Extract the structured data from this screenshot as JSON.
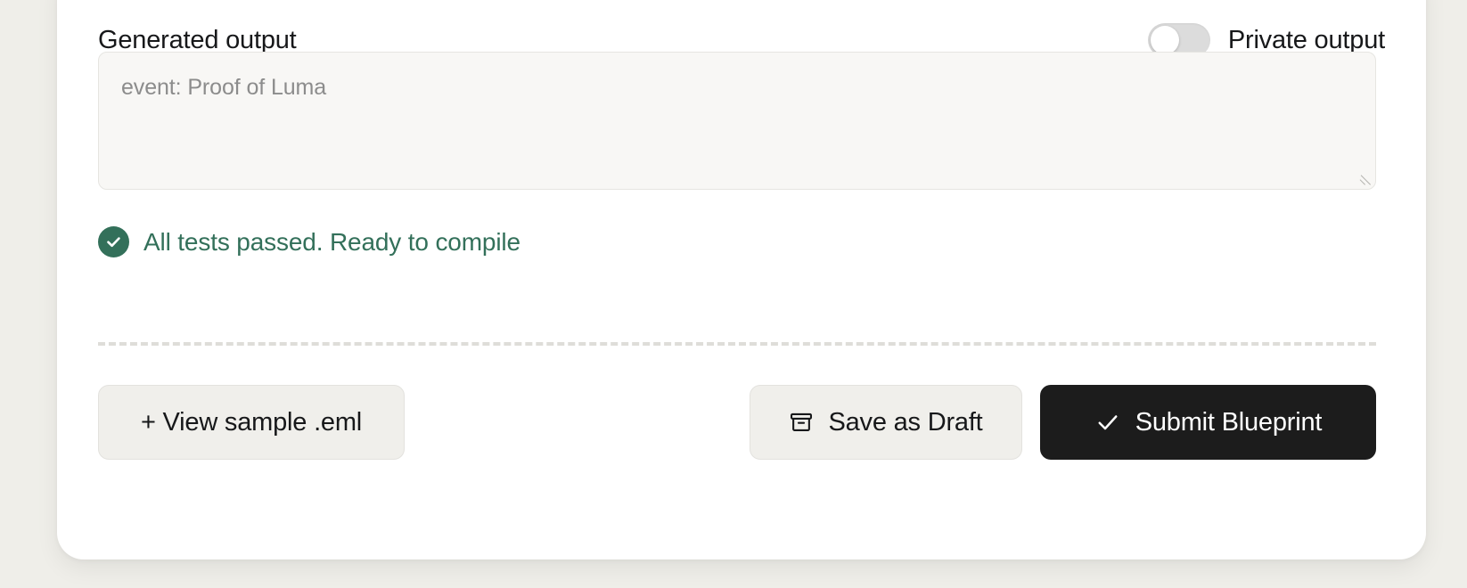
{
  "page": {
    "background_color": "#EFEEE9",
    "card_background": "#FFFFFF"
  },
  "section": {
    "title": "Generated output"
  },
  "private_toggle": {
    "label": "Private output",
    "state": "off",
    "track_color": "#DCDCDC",
    "knob_color": "#FFFFFF"
  },
  "generated_output": {
    "value": "",
    "placeholder": "event: Proof of Luma",
    "background_color": "#F8F7F5",
    "resizable": true
  },
  "status": {
    "icon": "check-circle-icon",
    "text": "All tests passed. Ready to compile",
    "color": "#33705A"
  },
  "footer": {
    "view_sample_label": "+ View sample .eml",
    "save_draft_label": "Save as Draft",
    "save_draft_icon": "archive-box-icon",
    "submit_label": "Submit Blueprint",
    "submit_icon": "check-icon",
    "submit_background": "#1C1C1C"
  }
}
